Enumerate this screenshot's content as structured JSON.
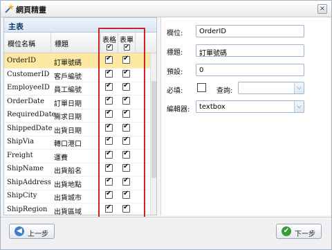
{
  "window": {
    "title": "網頁精靈",
    "close_glyph": "×"
  },
  "main": {
    "header": "主表",
    "columns": {
      "name": "欄位名稱",
      "title": "標題",
      "table": "表格",
      "form": "表單"
    },
    "header_checks": {
      "table": true,
      "form": true
    },
    "rows": [
      {
        "name": "OrderID",
        "title": "訂單號碼",
        "table": true,
        "form": true,
        "selected": true
      },
      {
        "name": "CustomerID",
        "title": "客戶編號",
        "table": true,
        "form": true
      },
      {
        "name": "EmployeeID",
        "title": "員工編號",
        "table": true,
        "form": true
      },
      {
        "name": "OrderDate",
        "title": "訂單日期",
        "table": true,
        "form": true
      },
      {
        "name": "RequiredDate",
        "title": "需求日期",
        "table": true,
        "form": true
      },
      {
        "name": "ShippedDate",
        "title": "出貨日期",
        "table": true,
        "form": true
      },
      {
        "name": "ShipVia",
        "title": "轉口港口",
        "table": true,
        "form": true
      },
      {
        "name": "Freight",
        "title": "運費",
        "table": true,
        "form": true
      },
      {
        "name": "ShipName",
        "title": "出貨船名",
        "table": true,
        "form": true
      },
      {
        "name": "ShipAddress",
        "title": "出貨地點",
        "table": true,
        "form": true
      },
      {
        "name": "ShipCity",
        "title": "出貨城市",
        "table": true,
        "form": true
      },
      {
        "name": "ShipRegion",
        "title": "出貨區域",
        "table": true,
        "form": true
      }
    ]
  },
  "detail": {
    "field_label": "欄位:",
    "field_value": "OrderID",
    "title_label": "標題:",
    "title_value": "訂單號碼",
    "default_label": "預設:",
    "default_value": "0",
    "required_label": "必填:",
    "required_checked": false,
    "query_label": "查詢:",
    "query_value": "",
    "editor_label": "編輯器:",
    "editor_value": "textbox"
  },
  "buttons": {
    "prev": "上一步",
    "next": "下一步"
  },
  "colors": {
    "selected_row": "#fde9a2",
    "highlight_box": "#cc2222",
    "header_blue": "#0f3a6b"
  }
}
